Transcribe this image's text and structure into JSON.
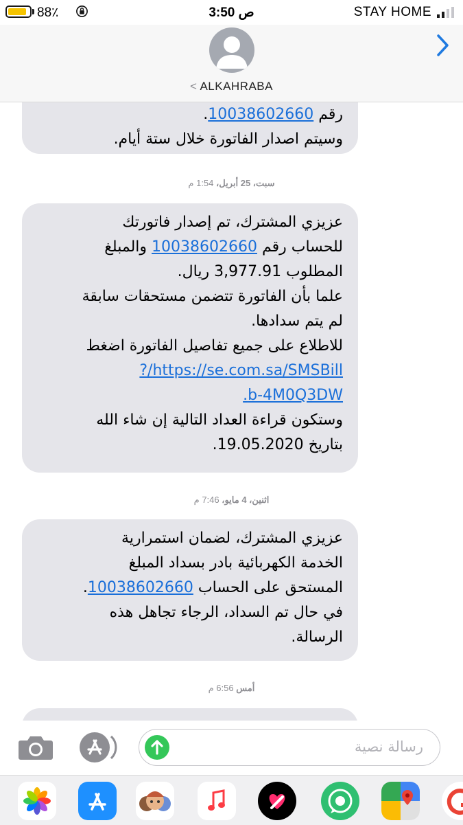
{
  "status_bar": {
    "battery_percent": "88٪",
    "battery_level": 0.88,
    "time": "3:50 ص",
    "carrier": "STAY HOME"
  },
  "header": {
    "contact_name": "ALKAHRABA",
    "back_glyph": "<"
  },
  "messages": [
    {
      "type": "bubble",
      "lines": [
        "رقم 10038602660.",
        "وسيتم اصدار الفاتورة خلال ستة أيام."
      ],
      "link": "10038602660"
    },
    {
      "type": "timestamp",
      "day": "سبت، 25 أبريل،",
      "time": "1:54 م"
    },
    {
      "type": "bubble",
      "intro": "عزيزي المشترك، تم إصدار فاتورتك",
      "account_prefix": "للحساب رقم",
      "account": "10038602660",
      "account_suffix": "والمبلغ",
      "amount_line": "المطلوب 3,977.91 ريال.",
      "note_1": "علما بأن الفاتورة تتضمن مستحقات سابقة",
      "note_2": "لم يتم سدادها.",
      "details_line": "للاطلاع على جميع تفاصيل الفاتورة اضغط",
      "link_1": "https://se.com.sa/SMSBill/?",
      "link_2": "b-4M0Q3DW.",
      "next_reading": "وستكون  قراءة العداد التالية إن شاء الله",
      "date_line": "بتاريخ 19.05.2020."
    },
    {
      "type": "timestamp",
      "day": "اثنين، 4 مايو،",
      "time": "7:46 م"
    },
    {
      "type": "bubble",
      "line_1": "عزيزي المشترك، لضمان استمرارية",
      "line_2": "الخدمة الكهربائية بادر بسداد المبلغ",
      "line_3_prefix": "المستحق على الحساب",
      "account": "10038602660",
      "line_3_suffix": ".",
      "line_4": "في حال تم السداد، الرجاء تجاهل هذه",
      "line_5": "الرسالة."
    },
    {
      "type": "timestamp",
      "day": "أمس",
      "time": "6:56 م"
    }
  ],
  "input_bar": {
    "placeholder": "رسالة نصية"
  },
  "app_drawer": {
    "apps": [
      "photos-icon",
      "app-store-icon",
      "memoji-icon",
      "music-icon",
      "digital-touch-icon",
      "whatsapp-sticker-icon",
      "google-maps-icon",
      "google-icon"
    ]
  },
  "colors": {
    "link": "#1a6fd9",
    "bubble_received": "#e5e5ea",
    "send_button": "#34c759",
    "battery": "#f5c400"
  }
}
